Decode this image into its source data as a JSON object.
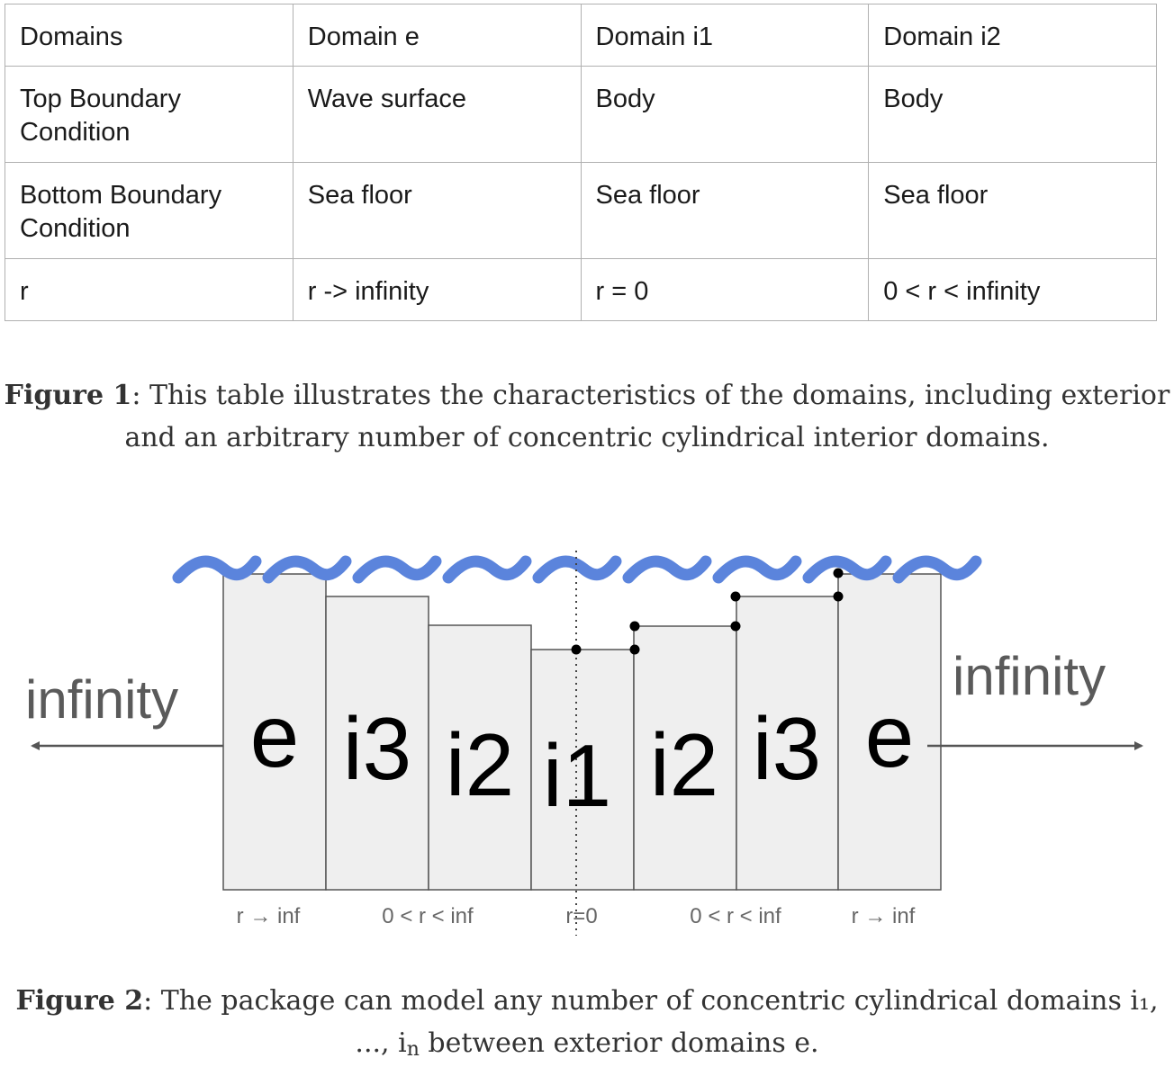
{
  "table": {
    "rows": [
      [
        "Domains",
        "Domain e",
        "Domain i1",
        "Domain i2"
      ],
      [
        "Top Boundary Condition",
        "Wave surface",
        "Body",
        "Body"
      ],
      [
        "Bottom Boundary Condition",
        "Sea floor",
        "Sea floor",
        "Sea floor"
      ],
      [
        "r",
        "r -> infinity",
        "r = 0",
        "0 < r < infinity"
      ]
    ]
  },
  "figure1": {
    "label": "Figure 1",
    "text": ": This table illustrates the characteristics of the domains, including exterior and an arbitrary number of concentric cylindrical interior domains."
  },
  "figure2": {
    "label": "Figure 2",
    "text_before_sub": ": The package can model any number of concentric cylindrical domains i₁, ..., i",
    "sub": "n",
    "text_after_sub": " between exterior domains e."
  },
  "diagram": {
    "left_infinity": "infinity",
    "right_infinity": "infinity",
    "domain_labels": [
      "e",
      "i3",
      "i2",
      "i1",
      "i2",
      "i3",
      "e"
    ],
    "r_labels": [
      "r → inf",
      "0 < r < inf",
      "r=0",
      "0 < r < inf",
      "r → inf"
    ],
    "colors": {
      "wave": "#5b84dc",
      "block_fill": "#efefef",
      "block_stroke": "#555555",
      "arrow": "#555555",
      "label": "#5a5a5a"
    }
  }
}
